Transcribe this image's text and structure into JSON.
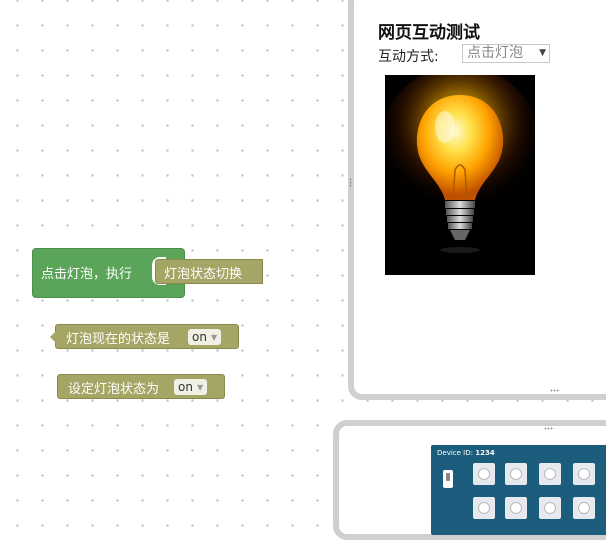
{
  "workspace": {
    "event_block": {
      "label": "点击灯泡，执行"
    },
    "toggle_block": {
      "label": "灯泡状态切换"
    },
    "state_value_block": {
      "label": "灯泡现在的状态是",
      "dropdown_value": "on"
    },
    "set_state_block": {
      "label": "设定灯泡状态为",
      "dropdown_value": "on"
    }
  },
  "preview_panel": {
    "title": "网页互动测试",
    "interaction_label": "互动方式:",
    "interaction_select": {
      "value": "点击灯泡"
    },
    "image": "lightbulb-on"
  },
  "device_panel": {
    "label": "Device ID:",
    "device_id": "1234"
  },
  "colors": {
    "event_block": "#5ba55b",
    "statement_block": "#a5a565",
    "panel_border": "#cfcfcf",
    "device_bg": "#1c5c7c"
  }
}
